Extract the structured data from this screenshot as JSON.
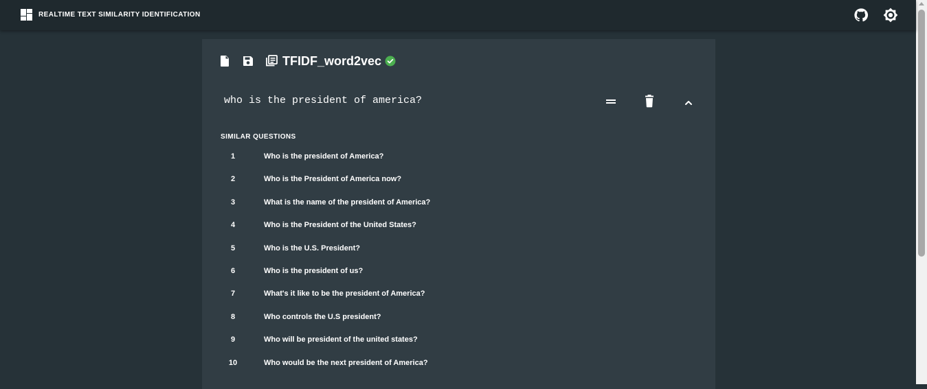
{
  "appbar": {
    "title": "REALTIME TEXT SIMILARITY IDENTIFICATION",
    "logo_icon": "dashboard-icon",
    "github_icon": "github-icon",
    "theme_icon": "brightness-icon"
  },
  "toolbar": {
    "new_icon": "file-icon",
    "save_icon": "save-icon",
    "library_icon": "library-icon",
    "model_name": "TFIDF_word2vec",
    "status_icon": "check-circle-icon",
    "status_color": "#4caf50"
  },
  "query": {
    "text": "who is the president of america?",
    "compare_icon": "equal-icon",
    "delete_icon": "trash-icon",
    "collapse_icon": "chevron-up-icon"
  },
  "similar": {
    "heading": "SIMILAR QUESTIONS",
    "items": [
      {
        "rank": "1",
        "text": "Who is the president of America?"
      },
      {
        "rank": "2",
        "text": "Who is the President of America now?"
      },
      {
        "rank": "3",
        "text": "What is the name of the president of America?"
      },
      {
        "rank": "4",
        "text": "Who is the President of the United States?"
      },
      {
        "rank": "5",
        "text": "Who is the U.S. President?"
      },
      {
        "rank": "6",
        "text": "Who is the president of us?"
      },
      {
        "rank": "7",
        "text": "What's it like to be the president of America?"
      },
      {
        "rank": "8",
        "text": "Who controls the U.S president?"
      },
      {
        "rank": "9",
        "text": "Who will be president of the united states?"
      },
      {
        "rank": "10",
        "text": "Who would be the next president of America?"
      }
    ]
  },
  "colors": {
    "background": "#263238",
    "appbar": "#1f292e",
    "card": "#313d44",
    "text": "#ffffff"
  }
}
